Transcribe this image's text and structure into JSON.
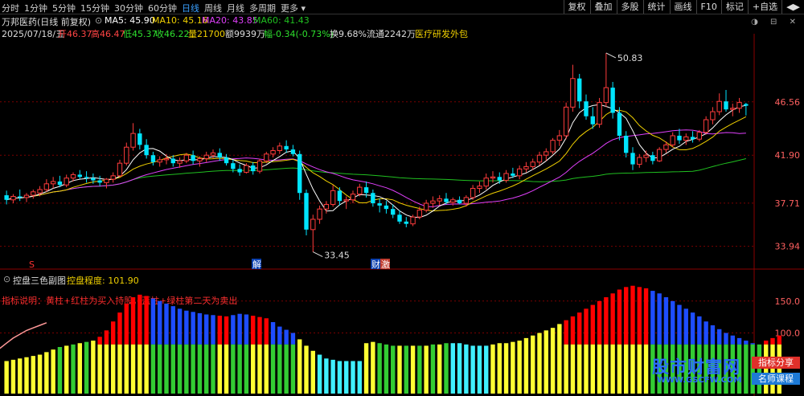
{
  "toolbar": {
    "periods": [
      "分时",
      "1分钟",
      "5分钟",
      "15分钟",
      "30分钟",
      "60分钟",
      "日线",
      "周线",
      "月线",
      "多周期",
      "更多 ▾"
    ],
    "active_period": "日线",
    "right_buttons": [
      "复权",
      "叠加",
      "多股",
      "统计",
      "画线",
      "F10",
      "标记",
      "+自选",
      "◀▶"
    ]
  },
  "header": {
    "stock": "万邦医药(日线 前复权)",
    "ma5": "MA5: 45.90",
    "ma10": "MA10: 45.16",
    "ma20": "MA20: 43.85",
    "ma60": "MA60: 41.43",
    "info_date": "2025/07/18/五",
    "info_open": "开46.37",
    "info_high": "高46.47",
    "info_low": "低45.37",
    "info_close": "收46.22",
    "info_vol": "量21700",
    "info_amount": "额9939万",
    "info_change": "幅-0.34(-0.73%)",
    "info_turnover": "换9.68%",
    "info_float": "流通2242万",
    "info_concept": "医疗研发外包",
    "window_icons": "◑ ⊟ ✕"
  },
  "main_chart": {
    "ylim": [
      32.3,
      52.3
    ],
    "y_ticks": [
      "46.56",
      "41.90",
      "37.71",
      "33.94"
    ],
    "y_tick_values": [
      46.56,
      41.9,
      37.71,
      33.94
    ],
    "annotation_high": "50.83",
    "annotation_high_value": 50.83,
    "annotation_low": "33.45",
    "annotation_low_value": 33.45,
    "markers": [
      "S",
      "解",
      "财",
      "激"
    ],
    "colors": {
      "up": "#ff3c3c",
      "down": "#00e5ff",
      "ma5": "#ffffff",
      "ma10": "#f0d000",
      "ma20": "#e040fb",
      "ma60": "#20c020"
    }
  },
  "indicator": {
    "title": "控盘三色副图",
    "level_label": "控盘程度: 101.90",
    "note": "指标说明：黄柱+红柱为买入持股，蓝柱+绿柱第二天为卖出",
    "y_ticks": [
      "150.0",
      "100.0"
    ],
    "y_tick_values": [
      150,
      100
    ],
    "ylim": [
      5,
      185
    ],
    "colors": {
      "red": "#ff0000",
      "blue": "#1e4dff",
      "yellow": "#ffff33",
      "green": "#33cc33",
      "cyan": "#40f0ff",
      "line": "#ff9999"
    }
  },
  "watermark": {
    "main": "股市财富网",
    "url": "WWW.GSCFW.COM",
    "badge1": "指标分享",
    "badge2": "名师课程"
  },
  "chart_data": {
    "type": "candlestick",
    "ohlc": [
      [
        38.4,
        38.8,
        37.6,
        38.0
      ],
      [
        38.0,
        38.5,
        37.7,
        38.3
      ],
      [
        38.3,
        38.9,
        37.9,
        38.2
      ],
      [
        38.2,
        38.6,
        37.8,
        38.4
      ],
      [
        38.4,
        38.9,
        38.1,
        38.7
      ],
      [
        38.6,
        39.2,
        38.3,
        38.9
      ],
      [
        38.9,
        39.8,
        38.7,
        39.4
      ],
      [
        39.4,
        40.0,
        39.0,
        39.6
      ],
      [
        39.6,
        40.1,
        39.1,
        39.3
      ],
      [
        39.3,
        40.2,
        39.1,
        39.9
      ],
      [
        39.9,
        40.4,
        39.6,
        40.2
      ],
      [
        40.2,
        40.6,
        39.8,
        40.0
      ],
      [
        40.0,
        40.5,
        39.5,
        39.9
      ],
      [
        39.9,
        40.3,
        39.4,
        39.7
      ],
      [
        39.7,
        40.1,
        39.2,
        39.5
      ],
      [
        39.5,
        39.9,
        39.0,
        39.8
      ],
      [
        39.8,
        40.4,
        39.5,
        40.1
      ],
      [
        40.1,
        41.5,
        40.0,
        41.2
      ],
      [
        41.2,
        43.0,
        41.0,
        42.6
      ],
      [
        42.6,
        44.7,
        42.3,
        43.8
      ],
      [
        43.8,
        44.2,
        42.4,
        42.8
      ],
      [
        42.8,
        43.3,
        41.6,
        41.9
      ],
      [
        41.9,
        42.2,
        41.0,
        41.3
      ],
      [
        41.3,
        41.8,
        40.9,
        41.5
      ],
      [
        41.5,
        42.0,
        41.1,
        41.6
      ],
      [
        41.6,
        41.9,
        40.9,
        41.2
      ],
      [
        41.2,
        41.7,
        40.8,
        41.4
      ],
      [
        41.4,
        42.1,
        41.2,
        41.9
      ],
      [
        41.9,
        42.3,
        41.1,
        41.4
      ],
      [
        41.4,
        41.8,
        40.9,
        41.6
      ],
      [
        41.6,
        42.2,
        41.3,
        41.9
      ],
      [
        41.9,
        42.4,
        41.6,
        42.1
      ],
      [
        42.1,
        42.5,
        41.4,
        41.7
      ],
      [
        41.7,
        42.0,
        41.0,
        41.2
      ],
      [
        41.2,
        41.5,
        40.4,
        40.7
      ],
      [
        40.7,
        41.1,
        40.1,
        40.4
      ],
      [
        40.4,
        41.2,
        40.3,
        41.0
      ],
      [
        41.0,
        41.3,
        40.2,
        40.5
      ],
      [
        40.5,
        41.6,
        40.3,
        41.4
      ],
      [
        41.4,
        42.2,
        41.2,
        42.0
      ],
      [
        42.0,
        42.6,
        41.7,
        42.3
      ],
      [
        42.3,
        43.0,
        42.0,
        42.7
      ],
      [
        42.7,
        43.2,
        42.1,
        42.4
      ],
      [
        42.4,
        42.8,
        41.8,
        42.0
      ],
      [
        42.0,
        42.3,
        38.0,
        38.6
      ],
      [
        38.6,
        38.9,
        34.9,
        35.4
      ],
      [
        35.4,
        36.7,
        33.45,
        36.3
      ],
      [
        36.3,
        37.5,
        35.9,
        37.2
      ],
      [
        37.2,
        37.9,
        36.8,
        37.6
      ],
      [
        37.6,
        39.3,
        37.4,
        38.8
      ],
      [
        38.8,
        39.1,
        37.5,
        37.9
      ],
      [
        37.9,
        38.3,
        37.2,
        38.0
      ],
      [
        38.0,
        38.8,
        37.7,
        38.5
      ],
      [
        38.5,
        39.4,
        38.3,
        39.1
      ],
      [
        39.1,
        39.6,
        38.2,
        38.6
      ],
      [
        38.6,
        38.9,
        37.4,
        37.7
      ],
      [
        37.7,
        38.1,
        36.9,
        37.5
      ],
      [
        37.5,
        37.9,
        36.8,
        37.2
      ],
      [
        37.2,
        37.6,
        36.4,
        36.7
      ],
      [
        36.7,
        37.1,
        35.9,
        36.1
      ],
      [
        36.1,
        36.5,
        35.6,
        35.9
      ],
      [
        35.9,
        36.7,
        35.7,
        36.5
      ],
      [
        36.5,
        37.4,
        36.3,
        37.1
      ],
      [
        37.1,
        38.0,
        36.9,
        37.7
      ],
      [
        37.7,
        38.3,
        37.3,
        37.9
      ],
      [
        37.9,
        38.4,
        37.5,
        38.1
      ],
      [
        38.1,
        38.6,
        37.6,
        37.8
      ],
      [
        37.8,
        38.2,
        37.5,
        38.0
      ],
      [
        38.0,
        38.3,
        37.6,
        37.7
      ],
      [
        37.7,
        38.4,
        37.4,
        38.2
      ],
      [
        38.2,
        39.3,
        38.0,
        39.0
      ],
      [
        39.0,
        39.6,
        38.6,
        39.2
      ],
      [
        39.2,
        40.3,
        38.9,
        39.9
      ],
      [
        39.9,
        40.5,
        39.5,
        40.0
      ],
      [
        40.0,
        40.4,
        39.4,
        39.7
      ],
      [
        39.7,
        40.6,
        39.5,
        40.3
      ],
      [
        40.3,
        40.8,
        39.9,
        40.1
      ],
      [
        40.1,
        41.0,
        39.8,
        40.7
      ],
      [
        40.7,
        41.3,
        40.4,
        40.9
      ],
      [
        40.9,
        41.6,
        40.6,
        41.3
      ],
      [
        41.3,
        42.2,
        41.0,
        41.9
      ],
      [
        41.9,
        42.5,
        41.4,
        42.2
      ],
      [
        42.2,
        43.4,
        42.0,
        43.2
      ],
      [
        43.2,
        44.1,
        42.7,
        43.6
      ],
      [
        43.6,
        46.5,
        43.3,
        46.1
      ],
      [
        46.1,
        49.8,
        45.7,
        48.6
      ],
      [
        48.6,
        49.0,
        46.0,
        46.6
      ],
      [
        46.6,
        47.2,
        45.0,
        45.3
      ],
      [
        45.3,
        46.1,
        44.2,
        44.6
      ],
      [
        44.6,
        46.9,
        44.3,
        46.5
      ],
      [
        46.5,
        50.83,
        46.1,
        47.8
      ],
      [
        47.8,
        48.3,
        45.1,
        45.6
      ],
      [
        45.6,
        46.1,
        43.2,
        43.6
      ],
      [
        43.6,
        44.0,
        41.7,
        42.1
      ],
      [
        42.1,
        42.6,
        40.6,
        41.1
      ],
      [
        41.1,
        42.0,
        40.8,
        41.7
      ],
      [
        41.7,
        42.3,
        41.3,
        41.9
      ],
      [
        41.9,
        42.2,
        41.1,
        41.4
      ],
      [
        41.4,
        42.6,
        41.3,
        42.4
      ],
      [
        42.4,
        43.1,
        42.1,
        42.8
      ],
      [
        42.8,
        43.9,
        42.6,
        43.6
      ],
      [
        43.6,
        44.2,
        42.9,
        43.2
      ],
      [
        43.2,
        43.8,
        42.8,
        43.5
      ],
      [
        43.5,
        44.0,
        43.0,
        43.3
      ],
      [
        43.3,
        44.1,
        43.1,
        43.9
      ],
      [
        43.9,
        45.3,
        43.7,
        45.0
      ],
      [
        45.0,
        46.1,
        44.6,
        45.7
      ],
      [
        45.7,
        47.3,
        45.4,
        46.6
      ],
      [
        46.6,
        47.6,
        45.7,
        45.9
      ],
      [
        45.9,
        46.4,
        45.3,
        46.0
      ],
      [
        46.0,
        46.9,
        45.6,
        46.5
      ],
      [
        46.37,
        46.47,
        45.37,
        46.22
      ]
    ],
    "indicator_bars": [
      {
        "kind": "line",
        "values": [
          20,
          28,
          36,
          44,
          52,
          58,
          64,
          68,
          72,
          76
        ]
      },
      {
        "kind": "bars",
        "colors": [
          "yellow",
          "yellow",
          "yellow",
          "yellow",
          "yellow",
          "yellow",
          "yellow",
          "yellow",
          "green",
          "yellow",
          "green",
          "yellow",
          "green",
          "yellow",
          "red",
          "red",
          "red",
          "red",
          "red",
          "red",
          "red",
          "red",
          "blue",
          "blue",
          "blue",
          "blue",
          "blue",
          "blue",
          "blue",
          "blue",
          "blue",
          "blue",
          "red",
          "red",
          "blue",
          "blue",
          "blue",
          "red",
          "red",
          "red",
          "blue",
          "blue",
          "blue",
          "blue",
          "yellow",
          "yellow",
          "yellow",
          "cyan",
          "cyan",
          "cyan",
          "cyan",
          "cyan",
          "cyan",
          "cyan",
          "yellow",
          "yellow",
          "green",
          "green",
          "green",
          "yellow",
          "green",
          "yellow",
          "green",
          "yellow",
          "green",
          "yellow",
          "green",
          "cyan",
          "cyan",
          "cyan",
          "cyan",
          "cyan",
          "cyan",
          "yellow",
          "yellow",
          "yellow",
          "yellow",
          "yellow",
          "yellow",
          "yellow",
          "yellow",
          "yellow",
          "yellow",
          "yellow",
          "red",
          "red",
          "red",
          "red",
          "red",
          "red",
          "red",
          "red",
          "red",
          "red",
          "red",
          "red",
          "red",
          "blue",
          "blue",
          "blue",
          "blue",
          "blue",
          "blue",
          "blue",
          "blue",
          "blue",
          "blue",
          "blue",
          "blue",
          "blue",
          "blue",
          "blue",
          "blue",
          "blue",
          "red",
          "red",
          "red"
        ],
        "heights": [
          56,
          58,
          60,
          62,
          64,
          66,
          70,
          74,
          78,
          80,
          82,
          84,
          86,
          88,
          94,
          104,
          118,
          132,
          146,
          156,
          160,
          158,
          154,
          150,
          146,
          142,
          138,
          135,
          133,
          131,
          129,
          128,
          127,
          126,
          128,
          130,
          129,
          127,
          125,
          123,
          117,
          110,
          105,
          100,
          90,
          80,
          72,
          66,
          60,
          58,
          56,
          56,
          56,
          56,
          84,
          86,
          84,
          82,
          80,
          80,
          80,
          80,
          80,
          80,
          82,
          82,
          84,
          84,
          84,
          82,
          80,
          80,
          80,
          82,
          84,
          84,
          86,
          88,
          92,
          96,
          100,
          104,
          108,
          114,
          120,
          126,
          132,
          138,
          144,
          150,
          156,
          162,
          168,
          172,
          174,
          172,
          170,
          166,
          162,
          156,
          150,
          144,
          138,
          132,
          126,
          118,
          112,
          106,
          100,
          96,
          92,
          88,
          84,
          82,
          88,
          92,
          96
        ]
      }
    ]
  }
}
